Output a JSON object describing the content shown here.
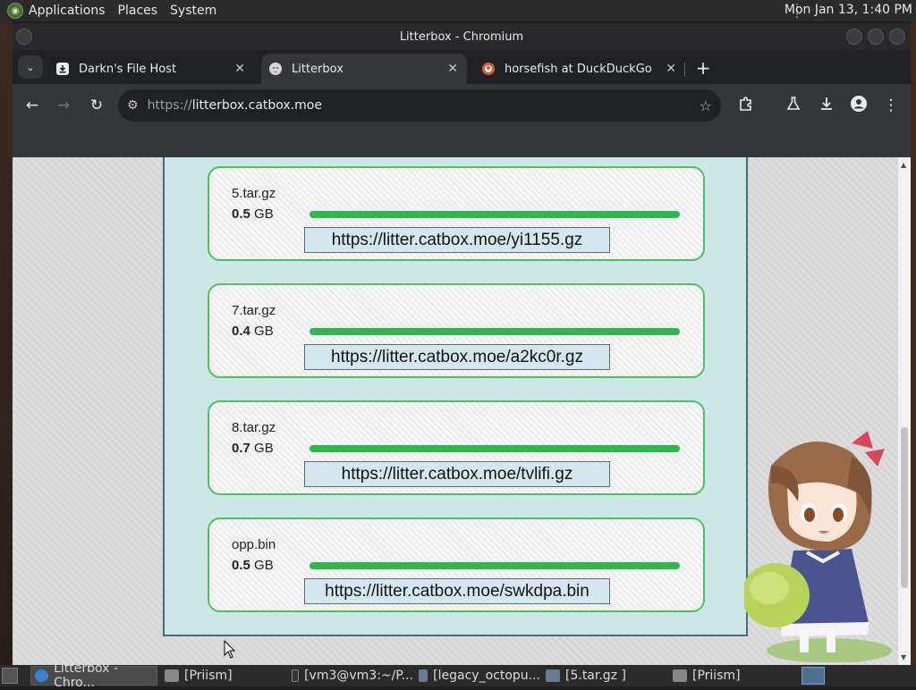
{
  "top_panel": {
    "menus": [
      "Applications",
      "Places",
      "System"
    ],
    "clock": "Mon Jan 13,  1:40 PM"
  },
  "window": {
    "title": "Litterbox - Chromium"
  },
  "tabs": [
    {
      "label": "Darkn's File Host",
      "icon": "download-icon",
      "active": false
    },
    {
      "label": "Litterbox",
      "icon": "cat-paw-icon",
      "active": true
    },
    {
      "label": "horsefish at DuckDuckGo",
      "icon": "duckduckgo-icon",
      "active": false
    }
  ],
  "omnibox": {
    "scheme": "https://",
    "host": "litterbox.catbox.moe"
  },
  "uploads": [
    {
      "filename": "5.tar.gz",
      "size_value": "0.5",
      "size_unit": "GB",
      "progress": 1.0,
      "link": "https://litter.catbox.moe/yi1155.gz"
    },
    {
      "filename": "7.tar.gz",
      "size_value": "0.4",
      "size_unit": "GB",
      "progress": 1.0,
      "link": "https://litter.catbox.moe/a2kc0r.gz"
    },
    {
      "filename": "8.tar.gz",
      "size_value": "0.7",
      "size_unit": "GB",
      "progress": 1.0,
      "link": "https://litter.catbox.moe/tvlifi.gz"
    },
    {
      "filename": "opp.bin",
      "size_value": "0.5",
      "size_unit": "GB",
      "progress": 1.0,
      "link": "https://litter.catbox.moe/swkdpa.bin"
    }
  ],
  "taskbar": {
    "items": [
      {
        "label": "Litterbox - Chro...",
        "active": true
      },
      {
        "label": "[Priism]",
        "active": false
      },
      {
        "label": "[vm3@vm3:~/P...",
        "active": false
      },
      {
        "label": "[legacy_octopu...",
        "active": false
      },
      {
        "label": "[5.tar.gz ]",
        "active": false
      },
      {
        "label": "[Priism]",
        "active": false
      }
    ]
  },
  "colors": {
    "progress": "#2db84c",
    "card_border": "#4fbf62",
    "panel_bg": "#cbe7e6",
    "link_bg": "#d4e7ef"
  }
}
